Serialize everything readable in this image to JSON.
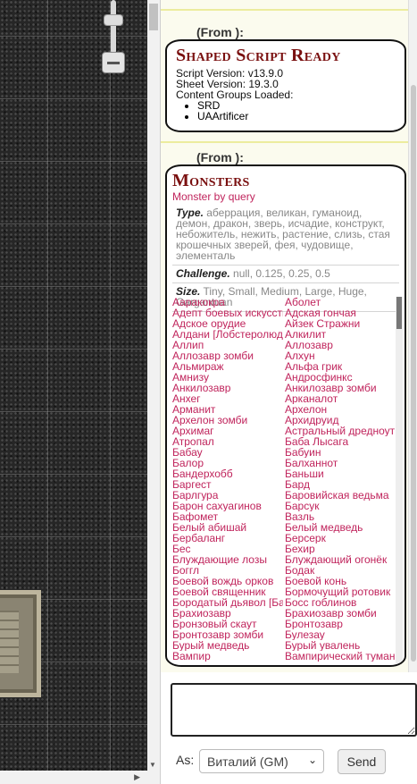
{
  "chat": {
    "from1": "(From ):",
    "ready": {
      "title": "Shaped Script Ready",
      "script_version": "Script Version: v13.9.0",
      "sheet_version": "Sheet Version: 19.3.0",
      "content_label": "Content Groups Loaded:",
      "groups": [
        "SRD",
        "UAArtificer"
      ]
    },
    "from2": "(From ):",
    "monsters": {
      "title": "Monsters",
      "subtitle": "Monster by query",
      "type_label": "Type.",
      "type_values": "аберрация, великан, гуманоид, демон, дракон, зверь, исчадие, конструкт, небожитель, нежить, растение, слизь, стая крошечных зверей, фея, чудовище, элементаль",
      "challenge_label": "Challenge.",
      "challenge_values": "null, 0.125, 0.25, 0.5",
      "size_label": "Size.",
      "size_values": "Tiny, Small, Medium, Large, Huge, Gargantuan",
      "list": [
        "Ааракокра",
        "Аболет",
        "Адепт боевых искусств",
        "Адская гончая",
        "Адское орудие",
        "Айзек Стражни",
        "Алдани [Лобстеролюд]",
        "Алкилит",
        "Аллип",
        "Аллозавр",
        "Аллозавр зомби",
        "Алхун",
        "Альмираж",
        "Альфа грик",
        "Амнизу",
        "Андросфинкс",
        "Анкилозавр",
        "Анкилозавр зомби",
        "Анхег",
        "Арканалот",
        "Арманит",
        "Архелон",
        "Архелон зомби",
        "Архидруид",
        "Архимаг",
        "Астральный дредноут",
        "Атропал",
        "Баба Лысага",
        "Бабау",
        "Бабуин",
        "Балор",
        "Балханнот",
        "Бандерхобб",
        "Баньши",
        "Баргест",
        "Бард",
        "Барлгура",
        "Баровийская ведьма",
        "Барон сахуагинов",
        "Барсук",
        "Бафомет",
        "Вазль",
        "Белый абишай",
        "Белый медведь",
        "Бербаланг",
        "Берсерк",
        "Бес",
        "Бехир",
        "Блуждающие лозы",
        "Блуждающий огонёк",
        "Боггл",
        "Бодак",
        "Боевой вождь орков",
        "Боевой конь",
        "Боевой священник",
        "Бормочущий ротовик",
        "Бородатый дьявол [Барбазу]",
        "Босс гоблинов",
        "Брахиозавр",
        "Брахиозавр зомби",
        "Бронзовый скаут",
        "Бронтозавр",
        "Бронтозавр зомби",
        "Булезау",
        "Бурый медведь",
        "Бурый увалень",
        "Вампир",
        "Вампирический туман"
      ]
    }
  },
  "input": {
    "value": ""
  },
  "as_label": "As:",
  "as_selected": "Виталий (GM)",
  "send_label": "Send"
}
